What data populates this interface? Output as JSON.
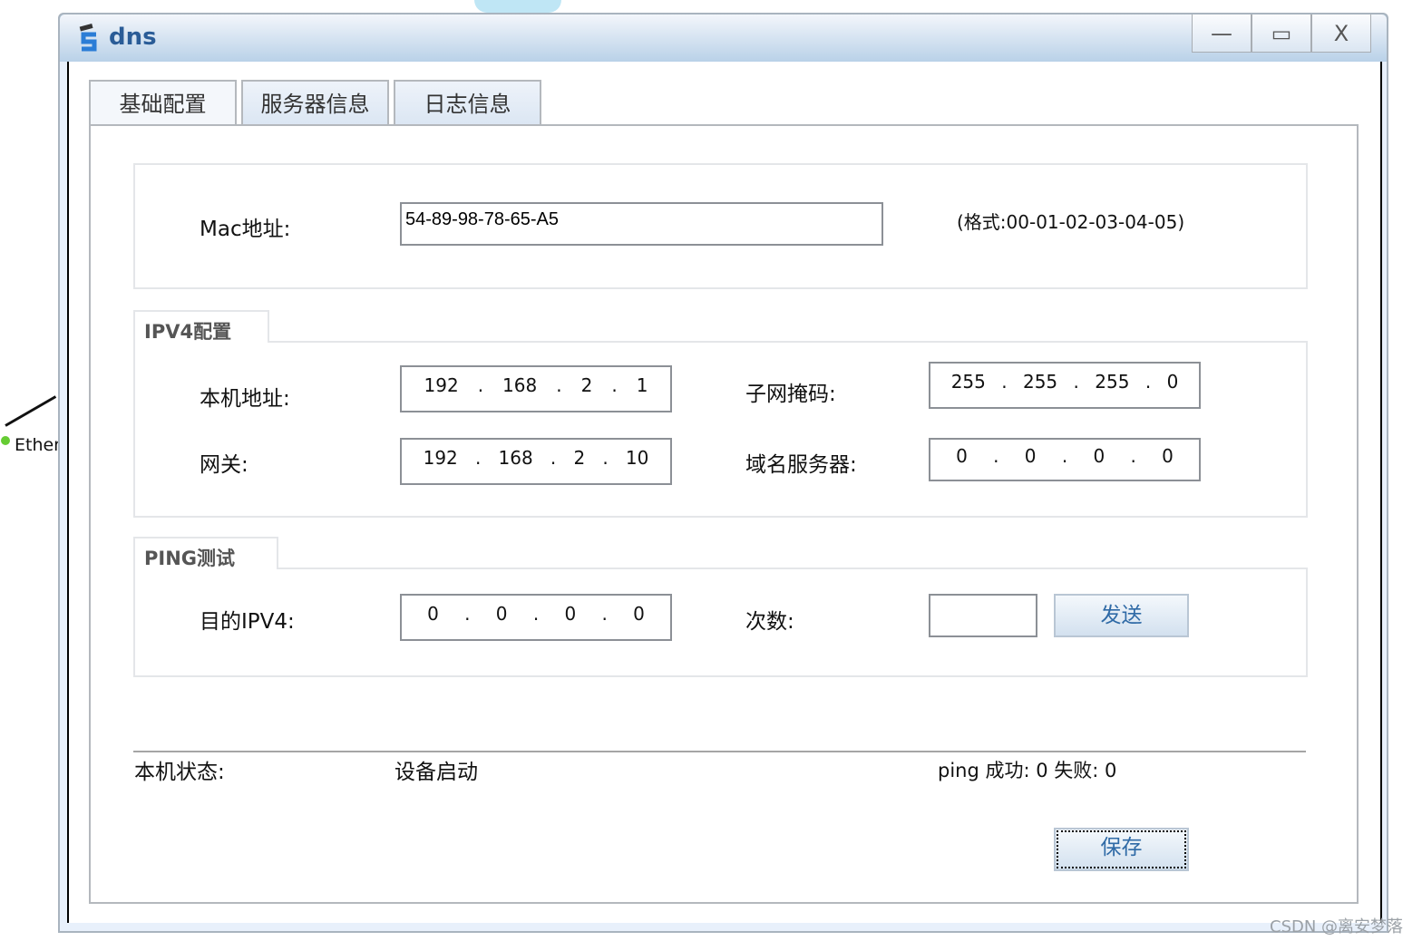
{
  "window": {
    "title": "dns",
    "minimize": "—",
    "maximize": "▭",
    "close": "X"
  },
  "tabs": [
    {
      "label": "基础配置"
    },
    {
      "label": "服务器信息"
    },
    {
      "label": "日志信息"
    }
  ],
  "mac": {
    "label": "Mac地址:",
    "value": "54-89-98-78-65-A5",
    "hint": "(格式:00-01-02-03-04-05)"
  },
  "ipv4": {
    "legend": "IPV4配置",
    "host_label": "本机地址:",
    "host": [
      "192",
      "168",
      "2",
      "1"
    ],
    "mask_label": "子网掩码:",
    "mask": [
      "255",
      "255",
      "255",
      "0"
    ],
    "gateway_label": "网关:",
    "gateway": [
      "192",
      "168",
      "2",
      "10"
    ],
    "dns_label": "域名服务器:",
    "dns": [
      "0",
      "0",
      "0",
      "0"
    ]
  },
  "ping": {
    "legend": "PING测试",
    "target_label": "目的IPV4:",
    "target": [
      "0",
      "0",
      "0",
      "0"
    ],
    "count_label": "次数:",
    "count": "",
    "send": "发送"
  },
  "status": {
    "label": "本机状态:",
    "value": "设备启动",
    "result": "ping 成功: 0 失败: 0"
  },
  "save": "保存",
  "background": {
    "link_label": "Ether"
  },
  "watermark": "CSDN @离安梦落"
}
